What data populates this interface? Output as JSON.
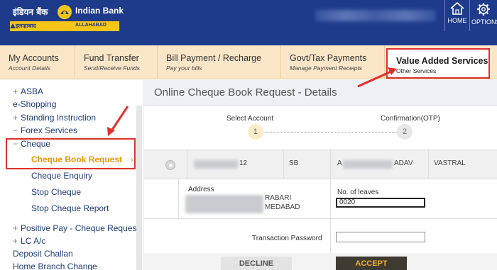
{
  "header": {
    "brand_hindi": "इंडियन बैंक",
    "brand_english": "Indian Bank",
    "strip_left": "इलाहाबाद",
    "strip_right": "ALLAHABAD",
    "home_label": "HOME",
    "options_label": "OPTIONS"
  },
  "nav": {
    "items": [
      {
        "title": "My Accounts",
        "sub": "Account Details"
      },
      {
        "title": "Fund Transfer",
        "sub": "Send/Receive Funds"
      },
      {
        "title": "Bill Payment / Recharge",
        "sub": "Pay your bills"
      },
      {
        "title": "Govt/Tax Payments",
        "sub": "Manage Payment Receipts"
      },
      {
        "title": "Value Added Services",
        "sub": "Other Services"
      }
    ]
  },
  "sidebar": {
    "asba": "ASBA",
    "eshopping": "e-Shopping",
    "standing": "Standing Instruction",
    "forex": "Forex Services",
    "cheque": "Cheque",
    "cheque_book_request": "Cheque Book Request",
    "cheque_enquiry": "Cheque Enquiry",
    "stop_cheque": "Stop Cheque",
    "stop_cheque_report": "Stop Cheque Report",
    "positive_pay": "Positive Pay - Cheque Request",
    "lc": "LC A/c",
    "deposit_challan": "Deposit Challan",
    "home_branch": "Home Branch Change",
    "plus": "+",
    "minus": "−",
    "arrow": "›"
  },
  "main": {
    "title": "Online Cheque Book Request - Details",
    "steps": [
      {
        "label": "Select Account",
        "num": "1"
      },
      {
        "label": "Confirmation(OTP)",
        "num": "2"
      }
    ],
    "account": {
      "number_tail": "12",
      "type": "SB",
      "name_head": "A",
      "name_tail": "ADAV",
      "branch": "VASTRAL"
    },
    "address_label": "Address",
    "address_line1": "RABARI",
    "address_line2": "MEDABAD",
    "leaves_label": "No. of leaves",
    "leaves_value": "0020",
    "password_label": "Transaction Password",
    "decline": "DECLINE",
    "accept": "ACCEPT"
  }
}
